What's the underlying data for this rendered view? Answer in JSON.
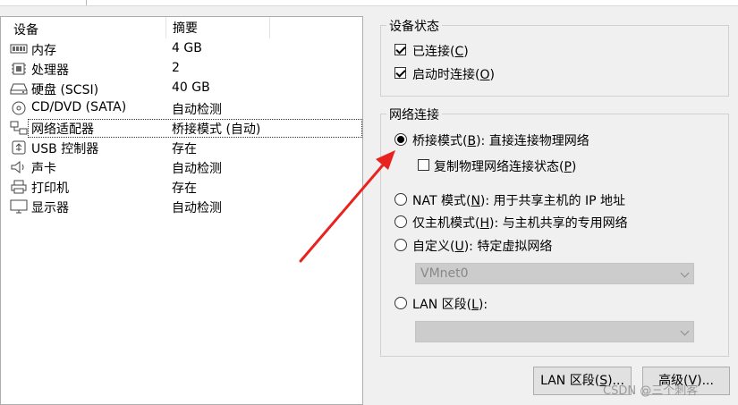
{
  "device_list": {
    "headers": {
      "device": "设备",
      "summary": "摘要"
    },
    "rows": [
      {
        "icon": "memory-icon",
        "name": "内存",
        "summary": "4 GB"
      },
      {
        "icon": "cpu-icon",
        "name": "处理器",
        "summary": "2"
      },
      {
        "icon": "hard-disk-icon",
        "name": "硬盘 (SCSI)",
        "summary": "40 GB"
      },
      {
        "icon": "cd-icon",
        "name": "CD/DVD (SATA)",
        "summary": "自动检测"
      },
      {
        "icon": "network-adapter-icon",
        "name": "网络适配器",
        "summary": "桥接模式 (自动)",
        "selected": true
      },
      {
        "icon": "usb-icon",
        "name": "USB 控制器",
        "summary": "存在"
      },
      {
        "icon": "sound-card-icon",
        "name": "声卡",
        "summary": "自动检测"
      },
      {
        "icon": "printer-icon",
        "name": "打印机",
        "summary": "存在"
      },
      {
        "icon": "display-icon",
        "name": "显示器",
        "summary": "自动检测"
      }
    ]
  },
  "device_status": {
    "title": "设备状态",
    "connected": {
      "text": "已连接(",
      "key": "C",
      "end": ")",
      "checked": true
    },
    "connect_on_start": {
      "text": "启动时连接(",
      "key": "O",
      "end": ")",
      "checked": true
    }
  },
  "network": {
    "title": "网络连接",
    "bridged": {
      "text": "桥接模式(",
      "key": "B",
      "end": "): 直接连接物理网络",
      "selected": true
    },
    "replicate": {
      "text": "复制物理网络连接状态(",
      "key": "P",
      "end": ")",
      "checked": false
    },
    "nat": {
      "text": "NAT 模式(",
      "key": "N",
      "end": "): 用于共享主机的 IP 地址",
      "selected": false
    },
    "host_only": {
      "text": "仅主机模式(",
      "key": "H",
      "end": "): 与主机共享的专用网络",
      "selected": false
    },
    "custom": {
      "text": "自定义(",
      "key": "U",
      "end": "): 特定虚拟网络",
      "selected": false
    },
    "custom_combo_value": "VMnet0",
    "lan_segment": {
      "text": "LAN 区段(",
      "key": "L",
      "end": "):",
      "selected": false
    },
    "lan_combo_value": ""
  },
  "buttons": {
    "lan_segments": {
      "text": "LAN 区段(",
      "key": "S",
      "end": ")..."
    },
    "advanced": {
      "text": "高级(",
      "key": "V",
      "end": ")..."
    }
  },
  "watermark": "CSDN @三个刺客",
  "colors": {
    "annotation_arrow": "#e8231f"
  }
}
